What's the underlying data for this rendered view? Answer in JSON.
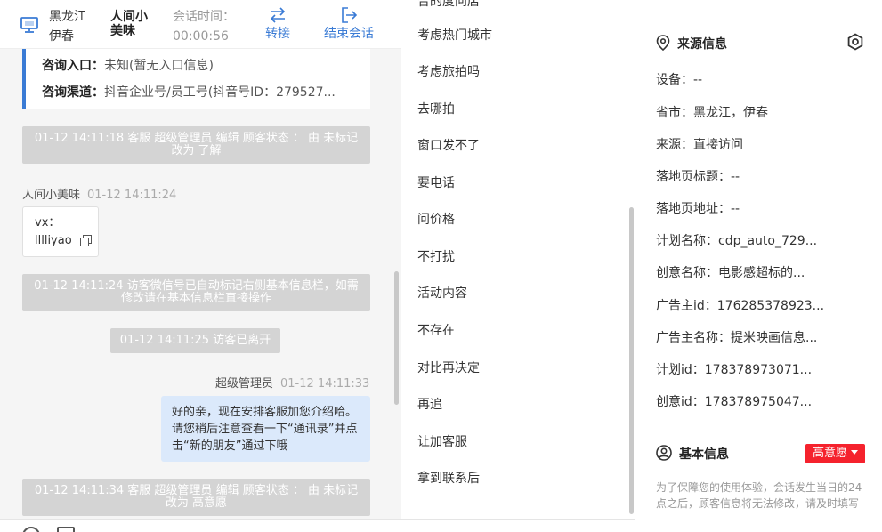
{
  "header": {
    "location_line1": "黑龙江",
    "location_line2": "伊春",
    "visitor_name": "人间小美味",
    "session_time_label": "会话时间：",
    "session_time_value": "00:00:56",
    "transfer_label": "转接",
    "end_label": "结束会话"
  },
  "chat": {
    "entry_label": "咨询入口：",
    "entry_value": "未知(暂无入口信息)",
    "channel_label": "咨询渠道：",
    "channel_value": "抖音企业号/员工号(抖音号ID：279527...",
    "sys1": "01-12 14:11:18 客服 超级管理员 编辑 顾客状态 ： 由 未标记 改为 了解",
    "visitor_sender": "人间小美味",
    "visitor_time": "01-12 14:11:24",
    "visitor_msg_line1": "vx：",
    "visitor_msg_line2": "lllliyao_",
    "sys2": "01-12 14:11:24 访客微信号已自动标记右侧基本信息栏，如需修改请在基本信息栏直接操作",
    "sys3": "01-12 14:11:25 访客已离开",
    "agent_sender": "超级管理员",
    "agent_time": "01-12 14:11:33",
    "agent_msg": "好的亲，现在安排客服加您介绍哈。请您稍后注意查看一下“通讯录”并点击“新的朋友”通过下哦",
    "sys4": "01-12 14:11:34 客服 超级管理员 编辑 顾客状态 ： 由 未标记 改为 高意愿"
  },
  "quick_replies": [
    "合的度问店",
    "考虑热门城市",
    "考虑旅拍吗",
    "去哪拍",
    "窗口发不了",
    "要电话",
    "问价格",
    "不打扰",
    "活动内容",
    "不存在",
    "对比再决定",
    "再追",
    "让加客服",
    "拿到联系后"
  ],
  "source": {
    "title": "来源信息",
    "fields": [
      "设备：--",
      "省市：黑龙江，伊春",
      "来源：直接访问",
      "落地页标题：--",
      "落地页地址：--",
      "计划名称：cdp_auto_729...",
      "创意名称：电影感超标的...",
      "广告主id：176285378923...",
      "广告主名称：提米映画信息...",
      "计划id：178378973071...",
      "创意id：178378975047..."
    ]
  },
  "basic": {
    "title": "基本信息",
    "intent_label": "高意愿",
    "notice": "为了保障您的使用体验，会话发生当日的24点之后，顾客信息将无法修改，请及时填写"
  },
  "colors": {
    "accent": "#3a7bd5",
    "intent_red": "#f5222d",
    "agent_bubble": "#dbe9fb",
    "system_msg": "#d4d4d4"
  }
}
